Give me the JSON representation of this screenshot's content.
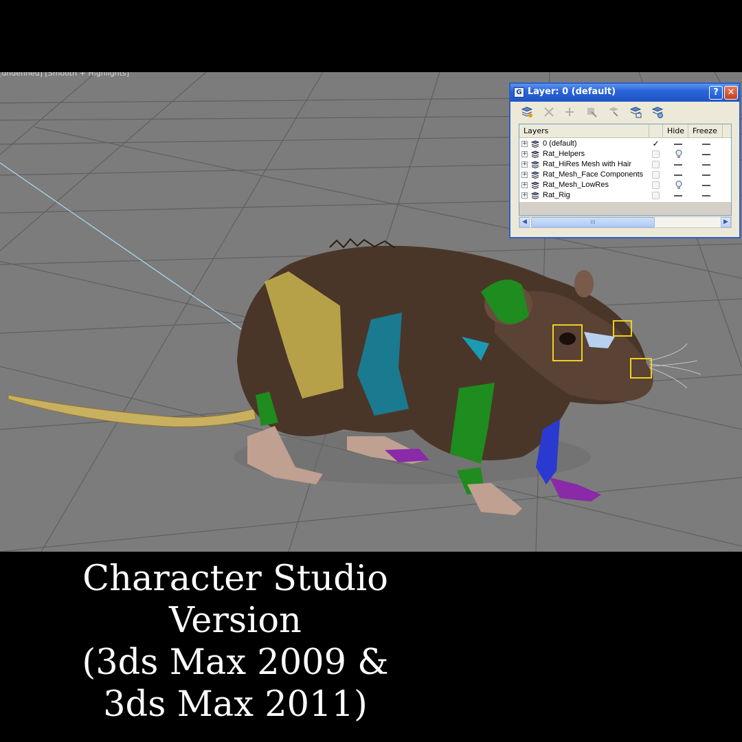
{
  "viewport": {
    "label": "[undefined] [Smooth + Highlights]",
    "background_color": "#7c7c7c",
    "grid_color": "#5f5f5f"
  },
  "layer_dialog": {
    "title": "Layer: 0 (default)",
    "app_icon": "3ds-max-icon",
    "help_label": "?",
    "close_label": "✕",
    "toolbar": [
      "new-layer-icon",
      "delete-layer-icon",
      "add-to-layer-icon",
      "select-objects-icon",
      "highlight-layer-icon",
      "hide-all-icon",
      "freeze-all-icon"
    ],
    "columns": {
      "layers": "Layers",
      "hide": "Hide",
      "freeze": "Freeze"
    },
    "rows": [
      {
        "name": "0 (default)",
        "active": true,
        "hidden": false,
        "frozen": false
      },
      {
        "name": "Rat_Helpers",
        "active": false,
        "hidden": true,
        "frozen": false
      },
      {
        "name": "Rat_HiRes Mesh with Hair",
        "active": false,
        "hidden": false,
        "frozen": false
      },
      {
        "name": "Rat_Mesh_Face Components",
        "active": false,
        "hidden": false,
        "frozen": false
      },
      {
        "name": "Rat_Mesh_LowRes",
        "active": false,
        "hidden": true,
        "frozen": false
      },
      {
        "name": "Rat_Rig",
        "active": false,
        "hidden": false,
        "frozen": false
      }
    ],
    "active_mark": "✓",
    "scroll_thumb_label": "III",
    "scroll_left_label": "◀",
    "scroll_right_label": "▶"
  },
  "caption": {
    "lines": [
      "Character Studio",
      "Version",
      "(3ds Max 2009 &",
      "3ds Max 2011)"
    ]
  },
  "colors": {
    "titlebar": "#2a64d8",
    "rat_fur": "#4a3628",
    "tail": "#c8b060",
    "rig_yellow": "#c9b44e",
    "rig_green": "#1e8c1e",
    "rig_teal": "#1a7a90",
    "rig_blue": "#2a3ad0",
    "rig_purple": "#8a2aa8"
  }
}
